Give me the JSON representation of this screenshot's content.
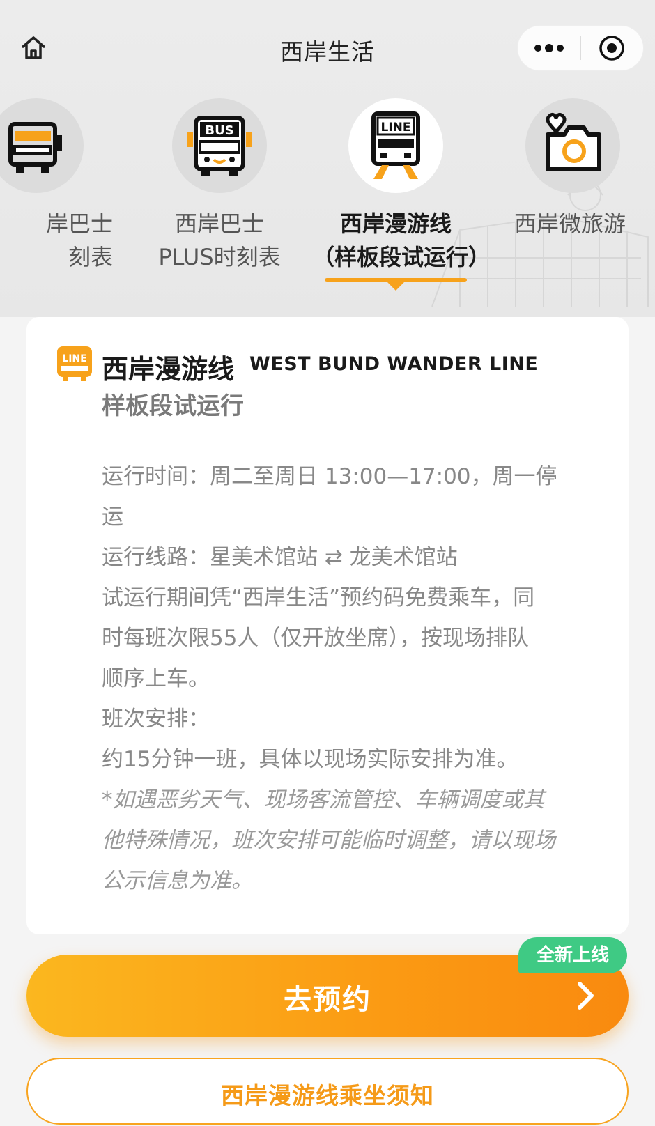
{
  "navbar": {
    "title": "西岸生活",
    "home_icon": "home-icon",
    "more_icon": "more-dots-icon",
    "close_icon": "target-circle-icon"
  },
  "categories": [
    {
      "line1": "岸巴士",
      "line2": "刻表",
      "icon": "bus-partial-icon",
      "active": false
    },
    {
      "line1": "西岸巴士",
      "line2": "PLUS时刻表",
      "icon": "bus-icon",
      "active": false
    },
    {
      "line1": "西岸漫游线",
      "line2": "（样板段试运行）",
      "icon": "line-bus-icon",
      "active": true
    },
    {
      "line1": "西岸微旅游",
      "line2": "",
      "icon": "camera-heart-icon",
      "active": false
    }
  ],
  "card": {
    "logo_icon": "line-logo-icon",
    "title": "西岸漫游线",
    "title_en": "WEST BUND WANDER LINE",
    "subtitle": "样板段试运行",
    "lines": [
      "运行时间：周二至周日 13:00—17:00，周一停",
      "运",
      "运行线路：星美术馆站 ⇄ 龙美术馆站",
      "试运行期间凭“西岸生活”预约码免费乘车，同",
      "时每班次限55人（仅开放坐席），按现场排队",
      "顺序上车。",
      "班次安排：",
      "约15分钟一班，具体以现场实际安排为准。"
    ],
    "note_lines": [
      "*如遇恶劣天气、现场客流管控、车辆调度或其",
      "他特殊情况，班次安排可能临时调整，请以现场",
      "公示信息为准。"
    ]
  },
  "book_button": {
    "label": "去预约",
    "badge": "全新上线"
  },
  "notice_button": {
    "label": "西岸漫游线乘坐须知"
  },
  "colors": {
    "accent": "#f7a21b",
    "badge": "#3fca84",
    "bg": "#f4f4f4"
  }
}
